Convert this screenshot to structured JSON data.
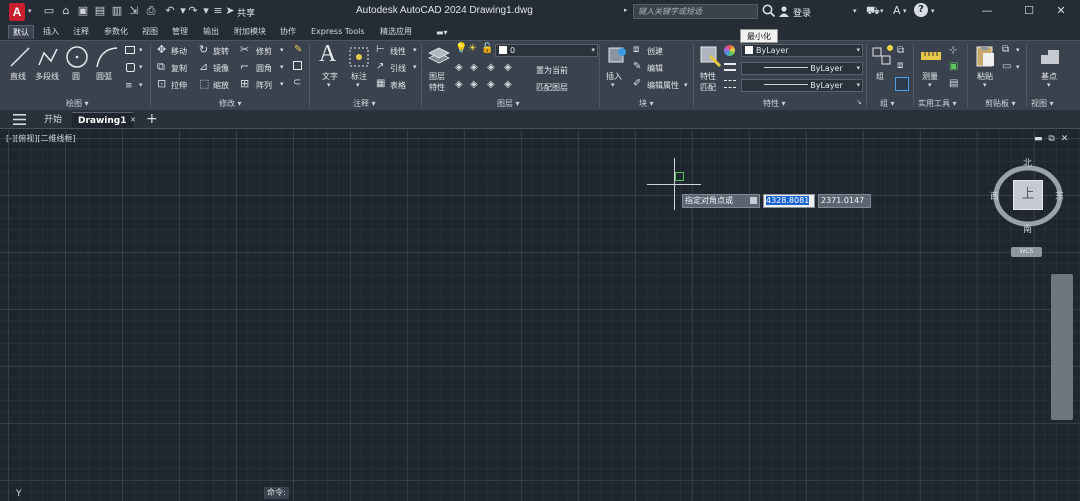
{
  "titlebar": {
    "logo_letter": "A",
    "share_label": "共享",
    "window_title": "Autodesk AutoCAD 2024    Drawing1.dwg",
    "search_placeholder": "键入关键字或短语",
    "login_label": "登录"
  },
  "tooltip": "最小化",
  "ribbon_tabs": [
    {
      "label": "默认",
      "active": true
    },
    {
      "label": "插入"
    },
    {
      "label": "注释"
    },
    {
      "label": "参数化"
    },
    {
      "label": "视图"
    },
    {
      "label": "管理"
    },
    {
      "label": "输出"
    },
    {
      "label": "附加模块"
    },
    {
      "label": "协作"
    },
    {
      "label": "Express Tools"
    },
    {
      "label": "精选应用"
    }
  ],
  "ribbon": {
    "draw": {
      "line": "直线",
      "polyline": "多段线",
      "circle": "圆",
      "arc": "圆弧",
      "title": "绘图"
    },
    "modify": {
      "move": "移动",
      "rotate": "旋转",
      "trim": "修剪",
      "copy": "复制",
      "mirror": "镜像",
      "fillet": "圆角",
      "stretch": "拉伸",
      "scale": "缩放",
      "array": "阵列",
      "title": "修改"
    },
    "annotation": {
      "text": "文字",
      "dimension": "标注",
      "leader": "引线",
      "table": "表格",
      "linear": "线性",
      "title": "注释"
    },
    "layers": {
      "layer_properties": "图层",
      "layer_properties2": "特性",
      "layer_name": "0",
      "make_current": "置为当前",
      "match_layer": "匹配图层",
      "title": "图层"
    },
    "block": {
      "insert": "插入",
      "create": "创建",
      "edit": "编辑",
      "edit_attributes": "编辑属性",
      "title": "块"
    },
    "properties": {
      "match": "特性",
      "match2": "匹配",
      "color": "ByLayer",
      "linetype": "ByLayer",
      "lineweight": "ByLayer",
      "title": "特性"
    },
    "groups": {
      "group": "组",
      "title": "组"
    },
    "utilities": {
      "measure": "测量",
      "title": "实用工具"
    },
    "clipboard": {
      "paste": "粘贴",
      "title": "剪贴板"
    },
    "view": {
      "base": "基点",
      "title": "视图"
    }
  },
  "filetabs": {
    "start": "开始",
    "drawing": "Drawing1"
  },
  "viewport": {
    "label": "[-][俯视][二维线框]"
  },
  "dynamic_input": {
    "prompt": "指定对角点或",
    "x": "4328.8081",
    "y": "2371.0147"
  },
  "viewcube": {
    "north": "北",
    "south": "南",
    "east": "东",
    "west": "西",
    "face": "上",
    "wcs": "WCS"
  },
  "command_label": "命令:",
  "ucs_y": "Y"
}
